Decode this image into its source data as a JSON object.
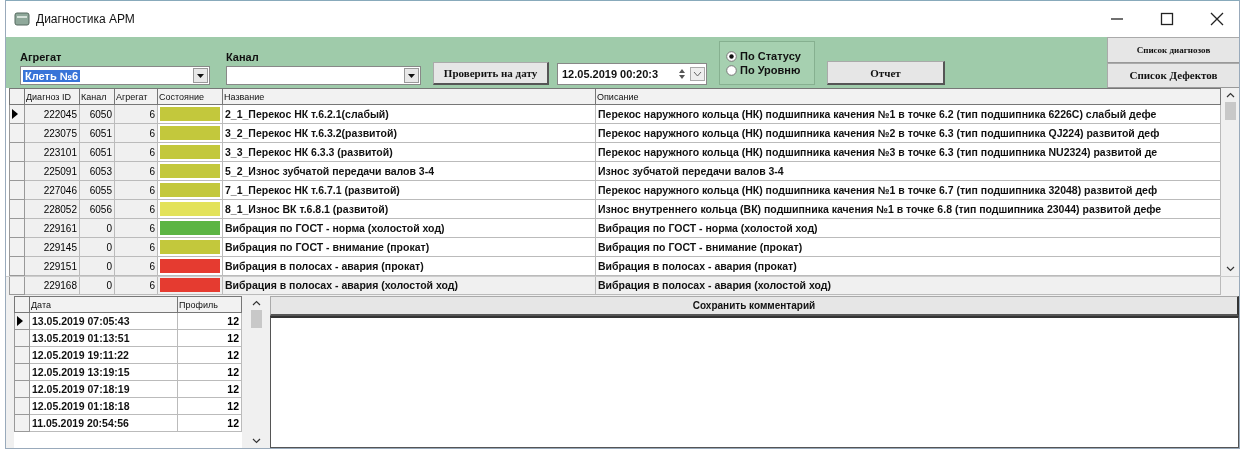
{
  "window": {
    "title": "Диагностика АРМ"
  },
  "toolbar": {
    "unit": {
      "label": "Агрегат",
      "value": "Клеть №6"
    },
    "channel": {
      "label": "Канал"
    },
    "check_button": "Проверить на дату",
    "datetime": "12.05.2019 00:20:3",
    "sort_mode": [
      {
        "label": "По Статусу",
        "selected": true
      },
      {
        "label": "По Уровню",
        "selected": false
      }
    ],
    "report_button": "Отчет",
    "diagnoses_button": "Список диагнозов",
    "defects_button": "Список Дефектов"
  },
  "diagnoses": {
    "columns": [
      "Диагноз ID",
      "Канал",
      "Агрегат",
      "Состояние",
      "Название",
      "Описание"
    ],
    "rows": [
      {
        "id": "222045",
        "channel": "6050",
        "unit": "6",
        "color": "#c3c83c",
        "name": "2_1_Перекос НК т.6.2.1(слабый)",
        "description": "Перекос наружного кольца (НК) подшипника качения №1 в точке 6.2 (тип подшипника 6226С) слабый дефе",
        "selected": true
      },
      {
        "id": "223075",
        "channel": "6051",
        "unit": "6",
        "color": "#c3c83c",
        "name": "3_2_Перекос НК т.6.3.2(развитой)",
        "description": "Перекос наружного кольца (НК) подшипника качения №2 в точке 6.3 (тип подшипника QJ224) развитой деф",
        "selected": false
      },
      {
        "id": "223101",
        "channel": "6051",
        "unit": "6",
        "color": "#c3c83c",
        "name": "3_3_Перекос НК 6.3.3 (развитой)",
        "description": "Перекос наружного кольца (НК) подшипника качения №3 в точке 6.3 (тип подшипника NU2324) развитой де",
        "selected": false
      },
      {
        "id": "225091",
        "channel": "6053",
        "unit": "6",
        "color": "#c3c83c",
        "name": "5_2_Износ зубчатой передачи валов 3-4",
        "description": "Износ зубчатой передачи валов 3-4",
        "selected": false
      },
      {
        "id": "227046",
        "channel": "6055",
        "unit": "6",
        "color": "#c3c83c",
        "name": "7_1_Перекос НК т.6.7.1 (развитой)",
        "description": "Перекос наружного кольца (НК) подшипника качения №1 в точке 6.7 (тип подшипника 32048) развитой деф",
        "selected": false
      },
      {
        "id": "228052",
        "channel": "6056",
        "unit": "6",
        "color": "#e3e25a",
        "name": "8_1_Износ ВК т.6.8.1 (развитой)",
        "description": "Износ внутреннего кольца (ВК) подшипника качения №1 в точке 6.8 (тип подшипника 23044) развитой дефе",
        "selected": false
      },
      {
        "id": "229161",
        "channel": "0",
        "unit": "6",
        "color": "#5cb544",
        "name": "Вибрация по ГОСТ - норма (холостой ход)",
        "description": "Вибрация по ГОСТ - норма (холостой ход)",
        "selected": false
      },
      {
        "id": "229145",
        "channel": "0",
        "unit": "6",
        "color": "#c3c83c",
        "name": "Вибрация по ГОСТ - внимание (прокат)",
        "description": "Вибрация по ГОСТ - внимание (прокат)",
        "selected": false
      },
      {
        "id": "229151",
        "channel": "0",
        "unit": "6",
        "color": "#e53b30",
        "name": "Вибрация в полосах - авария (прокат)",
        "description": "Вибрация в полосах - авария (прокат)",
        "selected": false
      },
      {
        "id": "229168",
        "channel": "0",
        "unit": "6",
        "color": "#e53b30",
        "name": "Вибрация в полосах - авария (холостой ход)",
        "description": "Вибрация в полосах - авария (холостой ход)",
        "selected": false
      }
    ]
  },
  "history": {
    "columns": [
      "Дата",
      "Профиль"
    ],
    "rows": [
      {
        "date": "13.05.2019 07:05:43",
        "profile": "12",
        "selected": true
      },
      {
        "date": "13.05.2019 01:13:51",
        "profile": "12",
        "selected": false
      },
      {
        "date": "12.05.2019 19:11:22",
        "profile": "12",
        "selected": false
      },
      {
        "date": "12.05.2019 13:19:15",
        "profile": "12",
        "selected": false
      },
      {
        "date": "12.05.2019 07:18:19",
        "profile": "12",
        "selected": false
      },
      {
        "date": "12.05.2019 01:18:18",
        "profile": "12",
        "selected": false
      },
      {
        "date": "11.05.2019 20:54:56",
        "profile": "12",
        "selected": false
      }
    ]
  },
  "comment": {
    "save_button": "Сохранить комментарий"
  }
}
